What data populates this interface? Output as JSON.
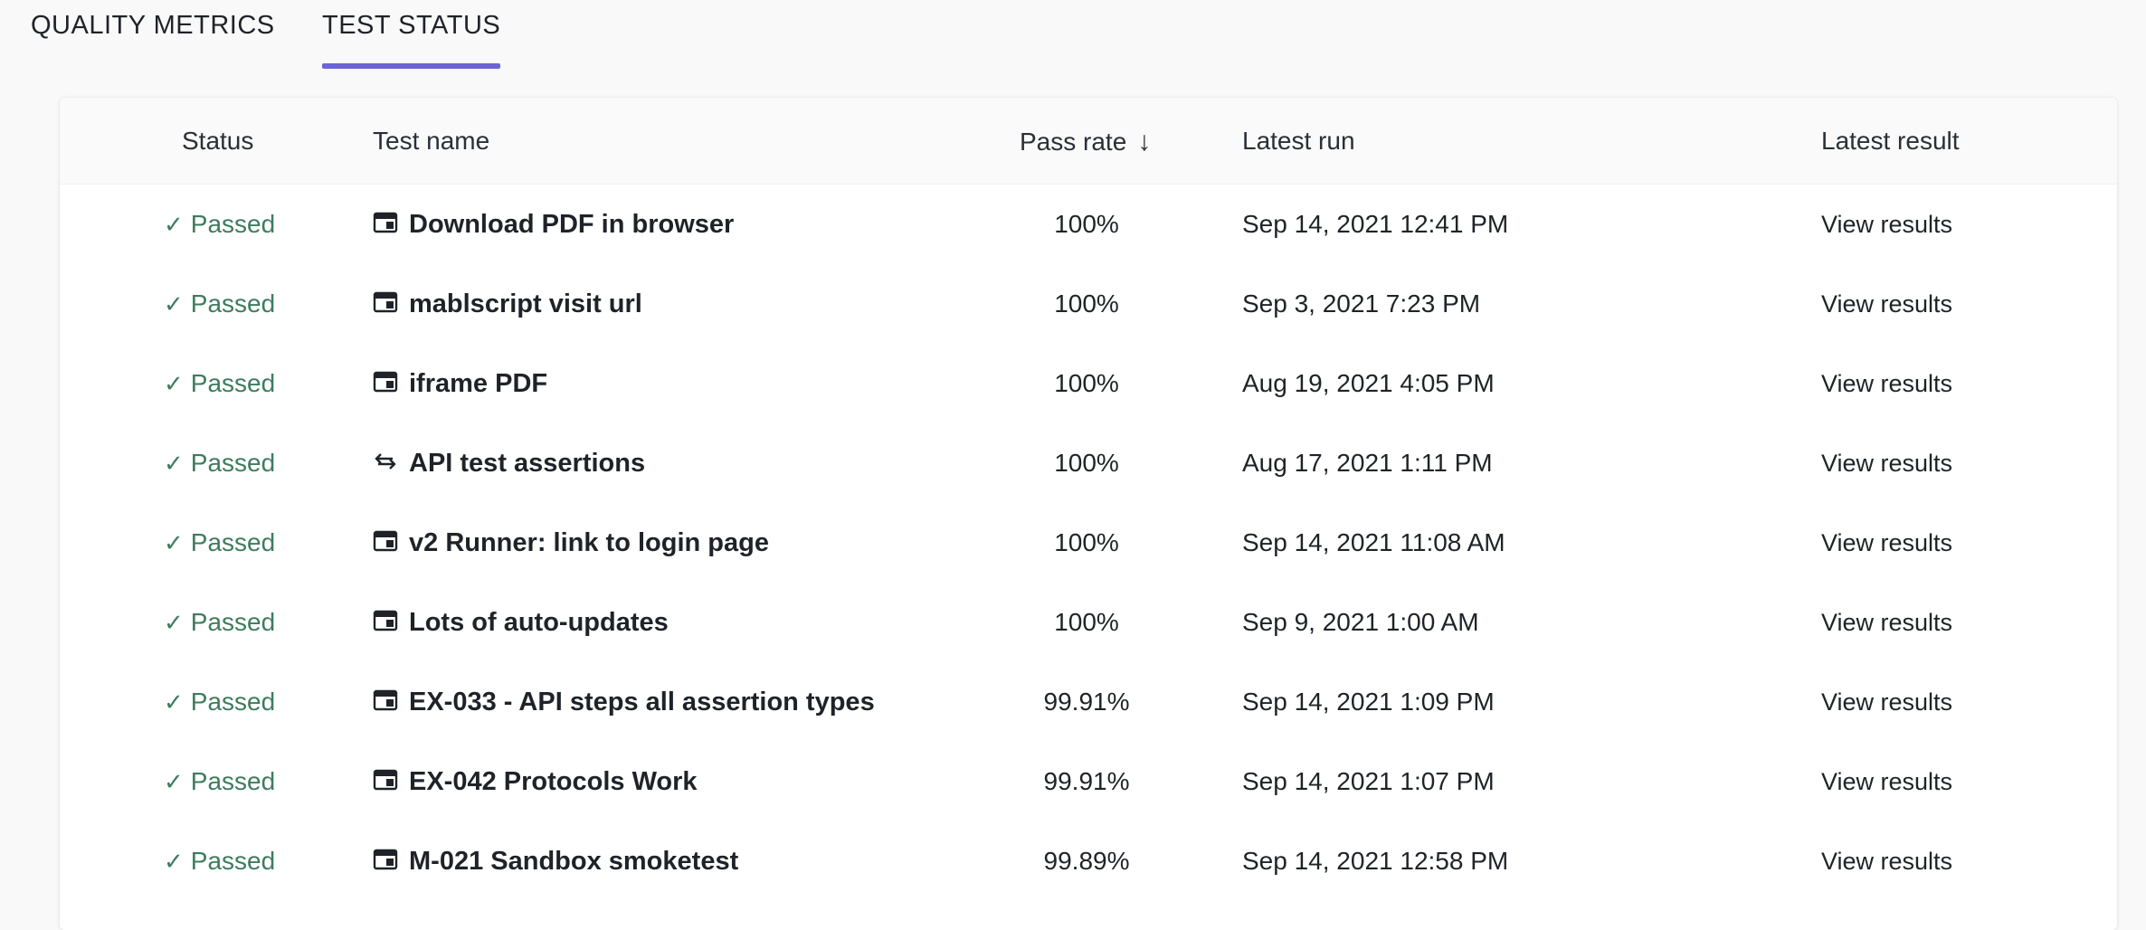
{
  "tabs": [
    {
      "label": "QUALITY METRICS",
      "active": false
    },
    {
      "label": "TEST STATUS",
      "active": true
    }
  ],
  "table": {
    "headers": {
      "status": "Status",
      "test_name": "Test name",
      "pass_rate": "Pass rate",
      "latest_run": "Latest run",
      "latest_result": "Latest result"
    },
    "sort_icon": "arrow-down-icon",
    "rows": [
      {
        "status": "Passed",
        "icon": "browser-icon",
        "name": "Download PDF in browser",
        "pass_rate": "100%",
        "latest_run": "Sep 14, 2021 12:41 PM",
        "result": "View results"
      },
      {
        "status": "Passed",
        "icon": "browser-icon",
        "name": "mablscript visit url",
        "pass_rate": "100%",
        "latest_run": "Sep 3, 2021 7:23 PM",
        "result": "View results"
      },
      {
        "status": "Passed",
        "icon": "browser-icon",
        "name": "iframe PDF",
        "pass_rate": "100%",
        "latest_run": "Aug 19, 2021 4:05 PM",
        "result": "View results"
      },
      {
        "status": "Passed",
        "icon": "api-icon",
        "name": "API test assertions",
        "pass_rate": "100%",
        "latest_run": "Aug 17, 2021 1:11 PM",
        "result": "View results"
      },
      {
        "status": "Passed",
        "icon": "browser-icon",
        "name": "v2 Runner: link to login page",
        "pass_rate": "100%",
        "latest_run": "Sep 14, 2021 11:08 AM",
        "result": "View results"
      },
      {
        "status": "Passed",
        "icon": "browser-icon",
        "name": "Lots of auto-updates",
        "pass_rate": "100%",
        "latest_run": "Sep 9, 2021 1:00 AM",
        "result": "View results"
      },
      {
        "status": "Passed",
        "icon": "browser-icon",
        "name": "EX-033 - API steps all assertion types",
        "pass_rate": "99.91%",
        "latest_run": "Sep 14, 2021 1:09 PM",
        "result": "View results"
      },
      {
        "status": "Passed",
        "icon": "browser-icon",
        "name": "EX-042 Protocols Work",
        "pass_rate": "99.91%",
        "latest_run": "Sep 14, 2021 1:07 PM",
        "result": "View results"
      },
      {
        "status": "Passed",
        "icon": "browser-icon",
        "name": "M-021 Sandbox smoketest",
        "pass_rate": "99.89%",
        "latest_run": "Sep 14, 2021 12:58 PM",
        "result": "View results"
      }
    ]
  },
  "colors": {
    "accent": "#6c63d9",
    "passed": "#3d7c5d"
  }
}
